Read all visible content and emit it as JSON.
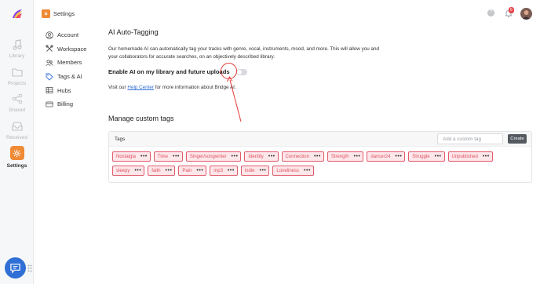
{
  "topbar": {
    "section_title": "Settings",
    "notification_count": "6"
  },
  "rail": {
    "items": [
      {
        "label": "Library"
      },
      {
        "label": "Projects"
      },
      {
        "label": "Shared"
      },
      {
        "label": "Received"
      },
      {
        "label": "Settings"
      }
    ]
  },
  "settings_nav": {
    "items": [
      {
        "label": "Account"
      },
      {
        "label": "Workspace"
      },
      {
        "label": "Members"
      },
      {
        "label": "Tags & AI"
      },
      {
        "label": "Hubs"
      },
      {
        "label": "Billing"
      }
    ]
  },
  "main": {
    "title": "AI Auto-Tagging",
    "description": "Our homemade AI can automatically tag your tracks with genre, vocal, instruments, mood, and more. This will allow you and your collaborators for accurate searches, on an objectively described library.",
    "toggle_label": "Enable AI on my library and future uploads",
    "toggle_on": false,
    "visit_prefix": "Visit our ",
    "help_link": "Help Center",
    "visit_suffix": " for more information about Bridge AI.",
    "manage_title": "Manage custom tags",
    "tags_header": "Tags",
    "add_placeholder": "Add a custom tag",
    "create_label": "Create",
    "tags": [
      "Nostalgia",
      "Time",
      "Singer/songwriter",
      "Identity",
      "Connection",
      "Strength",
      "dancer24",
      "Struggle",
      "Unpublished",
      "sleepy",
      "faith",
      "Pain",
      "mp3",
      "indie",
      "Loneliness"
    ]
  },
  "colors": {
    "accent": "#f08a35",
    "tag_border": "#e05a6a",
    "tag_bg": "#fde7ea",
    "link": "#2f6fd6",
    "annotation": "#e53935"
  }
}
